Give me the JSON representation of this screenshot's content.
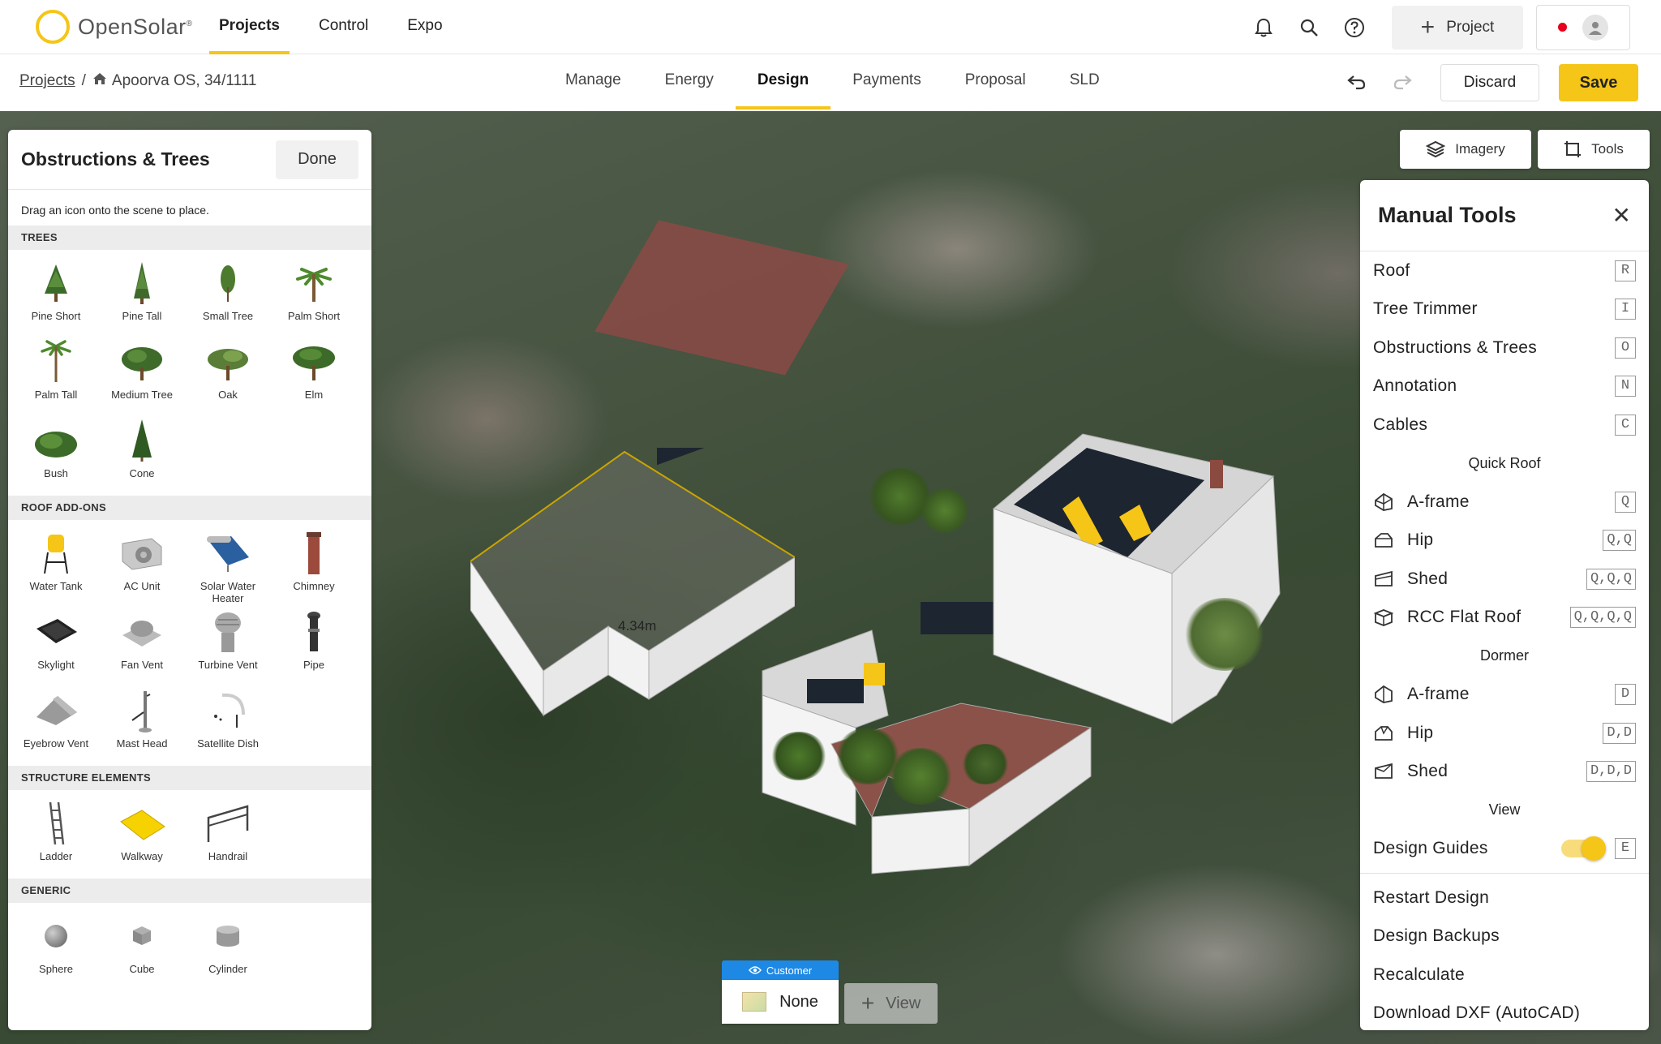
{
  "app": {
    "logo_text": "OpenSolar",
    "logo_mark": "®",
    "nav": [
      {
        "label": "Projects",
        "active": true
      },
      {
        "label": "Control",
        "active": false
      },
      {
        "label": "Expo",
        "active": false
      }
    ],
    "new_project_label": "Project",
    "accent_color": "#f5c518"
  },
  "subbar": {
    "breadcrumb_root": "Projects",
    "breadcrumb_separator": "/",
    "breadcrumb_current": "Apoorva OS, 34/1111",
    "tabs": [
      {
        "label": "Manage",
        "active": false
      },
      {
        "label": "Energy",
        "active": false
      },
      {
        "label": "Design",
        "active": true
      },
      {
        "label": "Payments",
        "active": false
      },
      {
        "label": "Proposal",
        "active": false
      },
      {
        "label": "SLD",
        "active": false
      }
    ],
    "discard_label": "Discard",
    "save_label": "Save"
  },
  "left_panel": {
    "title": "Obstructions & Trees",
    "done_label": "Done",
    "hint": "Drag an icon onto the scene to place.",
    "sections": [
      {
        "title": "TREES",
        "items": [
          {
            "label": "Pine Short",
            "icon": "pine-tree-icon"
          },
          {
            "label": "Pine Tall",
            "icon": "pine-tall-icon"
          },
          {
            "label": "Small Tree",
            "icon": "small-tree-icon"
          },
          {
            "label": "Palm Short",
            "icon": "palm-short-icon"
          },
          {
            "label": "Palm Tall",
            "icon": "palm-tall-icon"
          },
          {
            "label": "Medium Tree",
            "icon": "medium-tree-icon"
          },
          {
            "label": "Oak",
            "icon": "oak-icon"
          },
          {
            "label": "Elm",
            "icon": "elm-icon"
          },
          {
            "label": "Bush",
            "icon": "bush-icon"
          },
          {
            "label": "Cone",
            "icon": "cone-tree-icon"
          }
        ]
      },
      {
        "title": "ROOF ADD-ONS",
        "items": [
          {
            "label": "Water Tank",
            "icon": "water-tank-icon"
          },
          {
            "label": "AC Unit",
            "icon": "ac-unit-icon"
          },
          {
            "label": "Solar Water Heater",
            "icon": "solar-water-heater-icon"
          },
          {
            "label": "Chimney",
            "icon": "chimney-icon"
          },
          {
            "label": "Skylight",
            "icon": "skylight-icon"
          },
          {
            "label": "Fan Vent",
            "icon": "fan-vent-icon"
          },
          {
            "label": "Turbine Vent",
            "icon": "turbine-vent-icon"
          },
          {
            "label": "Pipe",
            "icon": "pipe-icon"
          },
          {
            "label": "Eyebrow Vent",
            "icon": "eyebrow-vent-icon"
          },
          {
            "label": "Mast Head",
            "icon": "mast-head-icon"
          },
          {
            "label": "Satellite Dish",
            "icon": "satellite-dish-icon"
          }
        ]
      },
      {
        "title": "STRUCTURE ELEMENTS",
        "items": [
          {
            "label": "Ladder",
            "icon": "ladder-icon"
          },
          {
            "label": "Walkway",
            "icon": "walkway-icon"
          },
          {
            "label": "Handrail",
            "icon": "handrail-icon"
          }
        ]
      },
      {
        "title": "GENERIC",
        "items": [
          {
            "label": "Sphere",
            "icon": "sphere-icon"
          },
          {
            "label": "Cube",
            "icon": "cube-icon"
          },
          {
            "label": "Cylinder",
            "icon": "cylinder-icon"
          }
        ]
      }
    ]
  },
  "scene": {
    "measurement_label": "4.34m",
    "imagery_label": "Imagery",
    "tools_label": "Tools",
    "customer_label": "Customer",
    "view_none_label": "None",
    "add_view_label": "View"
  },
  "manual_tools": {
    "title": "Manual Tools",
    "tools": [
      {
        "label": "Roof",
        "key": "R"
      },
      {
        "label": "Tree Trimmer",
        "key": "I"
      },
      {
        "label": "Obstructions & Trees",
        "key": "O"
      },
      {
        "label": "Annotation",
        "key": "N"
      },
      {
        "label": "Cables",
        "key": "C"
      }
    ],
    "quick_roof_heading": "Quick Roof",
    "quick_roof": [
      {
        "label": "A-frame",
        "key": "Q",
        "icon": "a-frame-roof-icon"
      },
      {
        "label": "Hip",
        "key": "Q,Q",
        "icon": "hip-roof-icon"
      },
      {
        "label": "Shed",
        "key": "Q,Q,Q",
        "icon": "shed-roof-icon"
      },
      {
        "label": "RCC Flat Roof",
        "key": "Q,Q,Q,Q",
        "icon": "flat-roof-icon"
      }
    ],
    "dormer_heading": "Dormer",
    "dormer": [
      {
        "label": "A-frame",
        "key": "D",
        "icon": "a-frame-dormer-icon"
      },
      {
        "label": "Hip",
        "key": "D,D",
        "icon": "hip-dormer-icon"
      },
      {
        "label": "Shed",
        "key": "D,D,D",
        "icon": "shed-dormer-icon"
      }
    ],
    "view_heading": "View",
    "design_guides_label": "Design Guides",
    "design_guides_key": "E",
    "design_guides_on": true,
    "actions": [
      {
        "label": "Restart Design"
      },
      {
        "label": "Design Backups"
      },
      {
        "label": "Recalculate"
      },
      {
        "label": "Download DXF (AutoCAD)"
      }
    ]
  }
}
